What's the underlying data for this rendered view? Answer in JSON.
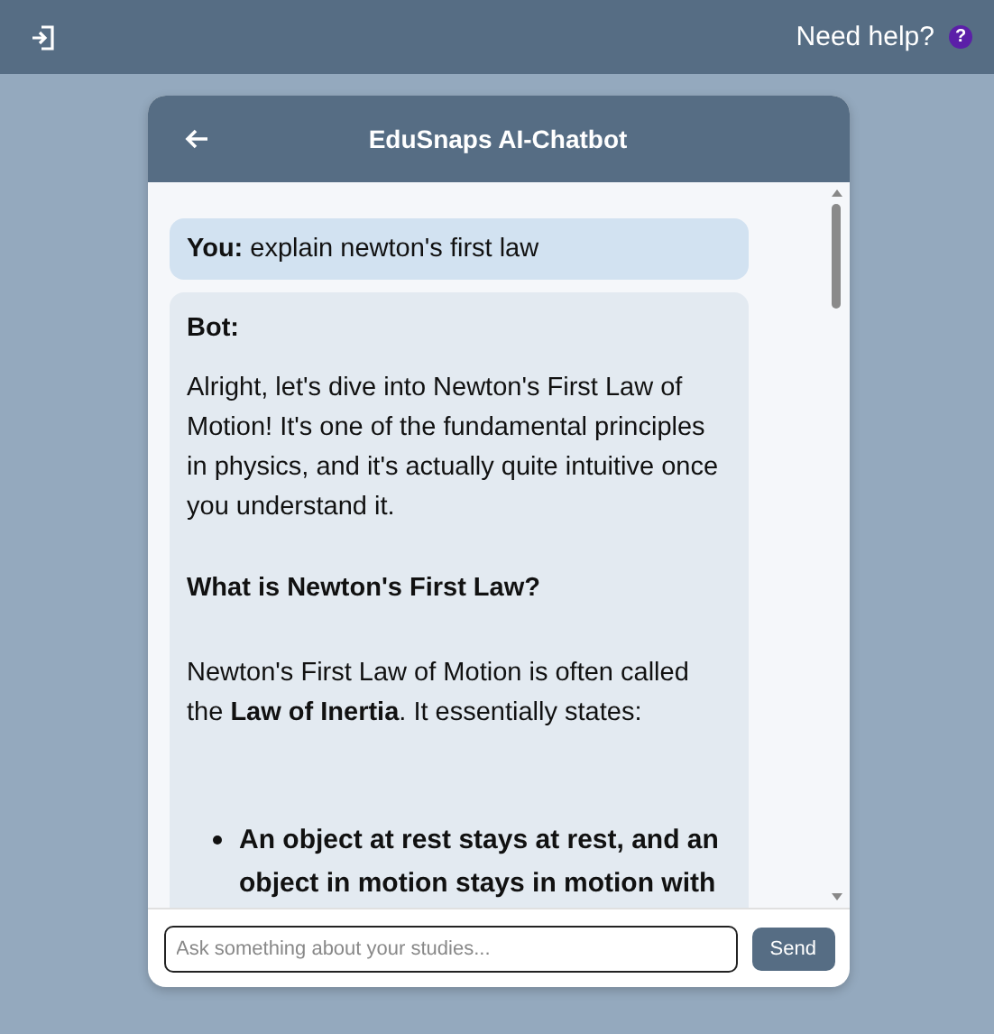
{
  "top_bar": {
    "help_link": "Need help?",
    "help_icon": "?"
  },
  "chat": {
    "title": "EduSnaps AI-Chatbot",
    "messages": [
      {
        "kind": "user",
        "sender": "You:",
        "text": "explain newton's first law"
      },
      {
        "kind": "bot",
        "sender": "Bot:",
        "blocks": [
          {
            "kind": "paragraph",
            "text": "Alright, let's dive into Newton's First Law of Motion! It's one of the fundamental principles in physics, and it's actually quite intuitive once you understand it."
          },
          {
            "kind": "heading",
            "text": "What is Newton's First Law?"
          },
          {
            "kind": "paragraph",
            "text": "Newton's First Law of Motion is often called the **Law of Inertia**. It essentially states:"
          },
          {
            "kind": "list",
            "items": [
              "An object at rest stays at rest, and an object in motion stays in motion with"
            ]
          }
        ]
      }
    ],
    "input": {
      "placeholder": "Ask something about your studies..."
    },
    "send_button": "Send"
  }
}
